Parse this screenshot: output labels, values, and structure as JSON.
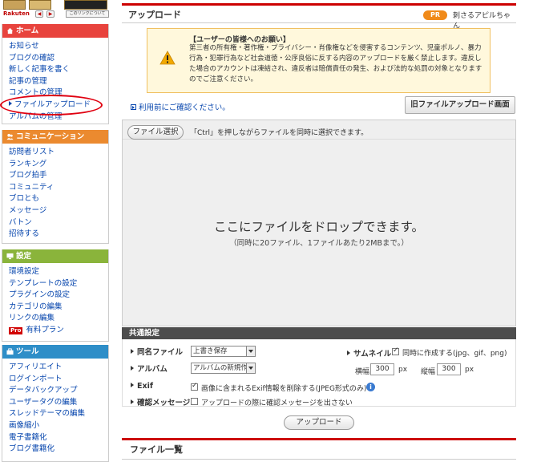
{
  "ad": {
    "rakuten": "Rakuten",
    "prev": "◀",
    "next": "▶",
    "link_label": "このリンクについて"
  },
  "sidebar": {
    "home": {
      "title": "ホーム",
      "items": [
        "お知らせ",
        "ブログの確認",
        "新しく記事を書く",
        "記事の管理",
        "コメントの管理",
        "ファイルアップロード",
        "アルバムの管理"
      ]
    },
    "communication": {
      "title": "コミュニケーション",
      "items": [
        "訪問者リスト",
        "ランキング",
        "ブログ拍手",
        "コミュニティ",
        "ブロとも",
        "メッセージ",
        "バトン",
        "招待する"
      ]
    },
    "settings": {
      "title": "設定",
      "items": [
        "環境設定",
        "テンプレートの設定",
        "プラグインの設定",
        "カテゴリの編集",
        "リンクの編集"
      ],
      "pro_badge": "Pro",
      "pro_label": "有料プラン"
    },
    "tools": {
      "title": "ツール",
      "items": [
        "アフィリエイト",
        "ログインポート",
        "データバックアップ",
        "ユーザータグの編集",
        "スレッドテーマの編集",
        "画像縮小",
        "電子書籍化",
        "ブログ書籍化"
      ]
    }
  },
  "header": {
    "title": "アップロード",
    "pr_badge": "PR",
    "pr_text": "刺さるアピルちゃん"
  },
  "notice": {
    "title": "【ユーザーの皆様へのお願い】",
    "body": "第三者の所有権・著作権・プライバシー・肖像権などを侵害するコンテンツ、児童ポルノ、暴力行為・犯罪行為など社会道徳・公序良俗に反する内容のアップロードを厳く禁止します。違反した場合のアカウントは凍結され、違反者は賠償責任の発生、および法的な処罰の対象となりますのでご注意ください。"
  },
  "confirm_link": "利用前にご確認ください。",
  "old_upload_button": "旧ファイルアップロード画面",
  "upload": {
    "select_button": "ファイル選択",
    "select_hint": "「Ctrl」を押しながらファイルを同時に選択できます。",
    "drop_main": "ここにファイルをドロップできます。",
    "drop_sub": "（同時に20ファイル、1ファイルあたり2MBまで。）"
  },
  "common": {
    "title": "共通設定",
    "same_name_label": "同名ファイル",
    "same_name_value": "上書き保存",
    "album_label": "アルバム",
    "album_value": "アルバムの新規作成",
    "exif_label": "Exif",
    "exif_option": "画像に含まれるExif情報を削除する(JPEG形式のみ)",
    "exif_checked": true,
    "confirm_label": "確認メッセージ",
    "confirm_option": "アップロードの際に確認メッセージを出さない",
    "confirm_checked": false,
    "thumb_label": "サムネイル",
    "thumb_option": "同時に作成する(jpg、gif、png)",
    "thumb_checked": true,
    "width_label": "横幅",
    "width_value": "300",
    "height_label": "縦幅",
    "height_value": "300",
    "unit": "px"
  },
  "upload_button": "アップロード",
  "file_list_title": "ファイル一覧",
  "colors": {
    "home": "#e8433d",
    "communication": "#eb8a2f",
    "settings": "#8ab43b",
    "tools": "#2e8ec8",
    "link": "#0645ad",
    "accent": "#cc0000"
  }
}
